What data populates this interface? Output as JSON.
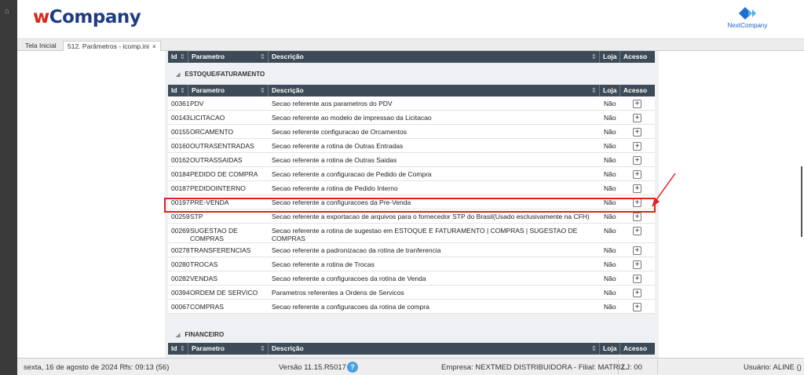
{
  "header": {
    "logo_w": "w",
    "logo_rest": "Company",
    "brand_right": "NextCompany"
  },
  "tabs": [
    {
      "label": "Tela Inicial"
    },
    {
      "label": "512. Parâmetros - icomp.ini",
      "close": "×"
    }
  ],
  "table_headers": {
    "id": "Id",
    "parametro": "Parametro",
    "descricao": "Descrição",
    "loja": "Loja",
    "acesso": "Acesso",
    "sort_glyph": "⇕"
  },
  "sections": {
    "estoque": "ESTOQUE/FATURAMENTO",
    "financeiro": "FINANCEIRO",
    "collapse_glyph": "◢"
  },
  "rows": [
    {
      "id": "00361",
      "param": "PDV",
      "desc": "Secao referente aos parametros do PDV",
      "loja": "Não",
      "acesso": "+"
    },
    {
      "id": "00143",
      "param": "LICITACAO",
      "desc": "Secao referente ao modelo de impressao da Licitacao",
      "loja": "Não",
      "acesso": "+"
    },
    {
      "id": "00155",
      "param": "ORCAMENTO",
      "desc": "Secao referente configuracao de Orcamentos",
      "loja": "Não",
      "acesso": "+"
    },
    {
      "id": "00160",
      "param": "OUTRASENTRADAS",
      "desc": "Secao referente a rotina de Outras Entradas",
      "loja": "Não",
      "acesso": "+"
    },
    {
      "id": "00162",
      "param": "OUTRASSAIDAS",
      "desc": "Secao referente a rotina de Outras Saidas",
      "loja": "Não",
      "acesso": "+"
    },
    {
      "id": "00184",
      "param": "PEDIDO DE COMPRA",
      "desc": "Secao referente a configuracao de Pedido de Compra",
      "loja": "Não",
      "acesso": "+"
    },
    {
      "id": "00187",
      "param": "PEDIDOINTERNO",
      "desc": "Secao referente a rotina de Pedido Interno",
      "loja": "Não",
      "acesso": "+"
    },
    {
      "id": "00197",
      "param": "PRE-VENDA",
      "desc": "Secao referente a configuracoes da Pre-Venda",
      "loja": "Não",
      "acesso": "+"
    },
    {
      "id": "00259",
      "param": "STP",
      "desc": "Secao referente a exportacao de arquivos para o fornecedor STP do Brasil(Usado esclusivamente na CFH)",
      "loja": "Não",
      "acesso": "+"
    },
    {
      "id": "00269",
      "param": "SUGESTAO DE COMPRAS",
      "desc": "Secao referente a rotina de sugestao em ESTOQUE E FATURAMENTO | COMPRAS | SUGESTAO DE COMPRAS",
      "loja": "Não",
      "acesso": "+"
    },
    {
      "id": "00278",
      "param": "TRANSFERENCIAS",
      "desc": "Secao referente a padronizacao da rotina de tranferencia",
      "loja": "Não",
      "acesso": "+"
    },
    {
      "id": "00280",
      "param": "TROCAS",
      "desc": "Secao referente a rotina de Trocas",
      "loja": "Não",
      "acesso": "+"
    },
    {
      "id": "00282",
      "param": "VENDAS",
      "desc": "Secao referente a configuracoes da rotina de Venda",
      "loja": "Não",
      "acesso": "+"
    },
    {
      "id": "00394",
      "param": "ORDEM DE SERVICO",
      "desc": "Parametros referentes a Ordens de Servicos",
      "loja": "Não",
      "acesso": "+"
    },
    {
      "id": "00067",
      "param": "COMPRAS",
      "desc": "Secao referente a configuracoes da rotina de compra",
      "loja": "Não",
      "acesso": "+"
    }
  ],
  "footer": {
    "date": "sexta, 16 de agosto de 2024  Rfs: 09:13 (56)",
    "version": "Versão 11.15.R5017",
    "help": "?",
    "empresa": "Empresa: NEXTMED DISTRIBUIDORA - Filial: MATRIZ",
    "lj": "LJ: 00",
    "user": "Usuário: ALINE ()"
  },
  "colors": {
    "header_bg": "#3d4a57",
    "highlight": "#e12020",
    "logo_red": "#d9261c",
    "logo_blue": "#1f3b82"
  }
}
